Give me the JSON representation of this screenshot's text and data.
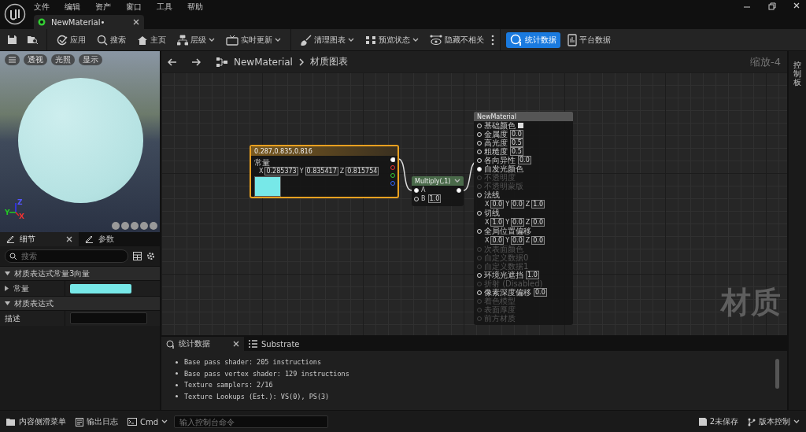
{
  "menu": [
    "文件",
    "编辑",
    "资产",
    "窗口",
    "工具",
    "帮助"
  ],
  "document_tab": {
    "title": "NewMaterial•",
    "selected": true
  },
  "toolbar": [
    {
      "label": "应用",
      "dropdown": false,
      "active": false
    },
    {
      "label": "搜索",
      "dropdown": false,
      "active": false
    },
    {
      "label": "主页",
      "dropdown": false,
      "active": false
    },
    {
      "label": "层级",
      "dropdown": true,
      "active": false
    },
    {
      "label": "实时更新",
      "dropdown": true,
      "active": false
    },
    {
      "label": "清理图表",
      "dropdown": true,
      "active": false
    },
    {
      "label": "预览状态",
      "dropdown": true,
      "active": false
    },
    {
      "label": "隐藏不相关",
      "dropdown": false,
      "active": false
    },
    {
      "label": "统计数据",
      "dropdown": false,
      "active": true
    },
    {
      "label": "平台数据",
      "dropdown": false,
      "active": false
    }
  ],
  "viewport": {
    "buttons": [
      "透视",
      "光照",
      "显示"
    ],
    "axes": [
      "Z",
      "Y",
      "X"
    ]
  },
  "details": {
    "tabs": [
      {
        "label": "细节",
        "selected": true
      },
      {
        "label": "参数",
        "selected": false
      }
    ],
    "search": {
      "placeholder": "搜索"
    },
    "sections": [
      {
        "title": "材质表达式常量3向量",
        "expanded": true,
        "rows": [
          {
            "label": "常量",
            "kind": "color",
            "expanded": false,
            "color": "#77e8e8"
          }
        ]
      },
      {
        "title": "材质表达式",
        "expanded": true,
        "rows": [
          {
            "label": "描述",
            "kind": "text",
            "value": ""
          }
        ]
      }
    ]
  },
  "graph": {
    "breadcrumb": [
      "NewMaterial",
      "材质图表"
    ],
    "zoom": "缩放-4",
    "label": "材质",
    "constant_node": {
      "title": "0.287,0.835,0.816",
      "label": "常量",
      "values": [
        {
          "axis": "X",
          "value": "0.285373"
        },
        {
          "axis": "Y",
          "value": "0.835417"
        },
        {
          "axis": "Z",
          "value": "0.815754"
        }
      ],
      "color": "#77e8e8"
    },
    "multiply_node": {
      "title": "Multiply(,1)",
      "inputs": [
        {
          "label": "A",
          "connected": true
        },
        {
          "label": "B",
          "value": "1.0",
          "connected": false
        }
      ]
    },
    "output_node": {
      "title": "NewMaterial",
      "pins": [
        {
          "label": "基础颜色",
          "kind": "color",
          "enabled": true,
          "connected": false
        },
        {
          "label": "金属度",
          "kind": "scalar",
          "value": "0.0",
          "enabled": true,
          "connected": false
        },
        {
          "label": "高光度",
          "kind": "scalar",
          "value": "0.5",
          "enabled": true,
          "connected": false
        },
        {
          "label": "粗糙度",
          "kind": "scalar",
          "value": "0.5",
          "enabled": true,
          "connected": false
        },
        {
          "label": "各向异性",
          "kind": "scalar",
          "value": "0.0",
          "enabled": true,
          "connected": false
        },
        {
          "label": "自发光颜色",
          "kind": "plain",
          "enabled": true,
          "connected": true
        },
        {
          "label": "不透明度",
          "kind": "plain",
          "enabled": false,
          "connected": false
        },
        {
          "label": "不透明蒙版",
          "kind": "plain",
          "enabled": false,
          "connected": false
        },
        {
          "label": "法线",
          "kind": "vector",
          "values": [
            {
              "axis": "X",
              "value": "0.0"
            },
            {
              "axis": "Y",
              "value": "0.0"
            },
            {
              "axis": "Z",
              "value": "1.0"
            }
          ],
          "enabled": true,
          "connected": false
        },
        {
          "label": "切线",
          "kind": "vector",
          "values": [
            {
              "axis": "X",
              "value": "1.0"
            },
            {
              "axis": "Y",
              "value": "0.0"
            },
            {
              "axis": "Z",
              "value": "0.0"
            }
          ],
          "enabled": true,
          "connected": false
        },
        {
          "label": "全局位置偏移",
          "kind": "vector",
          "values": [
            {
              "axis": "X",
              "value": "0.0"
            },
            {
              "axis": "Y",
              "value": "0.0"
            },
            {
              "axis": "Z",
              "value": "0.0"
            }
          ],
          "enabled": true,
          "connected": false
        },
        {
          "label": "次表面颜色",
          "kind": "plain",
          "enabled": false,
          "connected": false
        },
        {
          "label": "自定义数据0",
          "kind": "plain",
          "enabled": false,
          "connected": false
        },
        {
          "label": "自定义数据1",
          "kind": "plain",
          "enabled": false,
          "connected": false
        },
        {
          "label": "环境光遮挡",
          "kind": "scalar",
          "value": "1.0",
          "enabled": true,
          "connected": false
        },
        {
          "label": "折射 (Disabled)",
          "kind": "plain",
          "enabled": false,
          "connected": false
        },
        {
          "label": "像素深度偏移",
          "kind": "scalar",
          "value": "0.0",
          "enabled": true,
          "connected": false
        },
        {
          "label": "着色模型",
          "kind": "plain",
          "enabled": false,
          "connected": false
        },
        {
          "label": "表面厚度",
          "kind": "plain",
          "enabled": false,
          "connected": false
        },
        {
          "label": "前方材质",
          "kind": "plain",
          "enabled": false,
          "connected": false
        }
      ]
    }
  },
  "side_tab": "控制板",
  "bottom_panel": {
    "tabs": [
      {
        "label": "统计数据",
        "selected": true
      },
      {
        "label": "Substrate",
        "selected": false
      }
    ],
    "lines": [
      "Base pass shader: 205 instructions",
      "Base pass vertex shader: 129 instructions",
      "Texture samplers: 2/16",
      "Texture Lookups (Est.): VS(0), PS(3)"
    ]
  },
  "status_bar": {
    "left": [
      "内容侧滑菜单",
      "输出日志"
    ],
    "cmd": "Cmd",
    "console": {
      "placeholder": "输入控制台命令"
    },
    "right": [
      "2未保存",
      "版本控制"
    ]
  }
}
